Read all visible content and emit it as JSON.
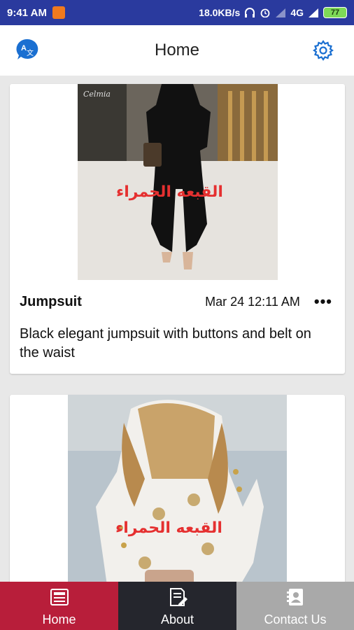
{
  "status_bar": {
    "time": "9:41 AM",
    "network_speed": "18.0KB/s",
    "network_type": "4G",
    "battery": "77"
  },
  "header": {
    "title": "Home",
    "translate_icon": "translate-icon",
    "settings_icon": "gear-icon"
  },
  "posts": [
    {
      "title": "Jumpsuit",
      "date": "Mar 24 12:11 AM",
      "more": "•••",
      "description": "Black elegant jumpsuit with buttons and belt on the waist",
      "watermark": "القبعه الحمراء"
    },
    {
      "title": "",
      "date": "",
      "description": "",
      "watermark": "القبعه الحمراء"
    }
  ],
  "bottom_nav": {
    "items": [
      {
        "label": "Home",
        "icon": "newspaper-icon",
        "active": true
      },
      {
        "label": "About",
        "icon": "document-edit-icon",
        "active": false
      },
      {
        "label": "Contact Us",
        "icon": "contact-book-icon",
        "active": false
      }
    ]
  },
  "colors": {
    "status_bar": "#2a3a9e",
    "accent_blue": "#1a6fd1",
    "nav_home": "#b81e3a",
    "nav_about": "#25262d",
    "nav_contact": "#a9a9a9",
    "watermark": "#e53030"
  }
}
